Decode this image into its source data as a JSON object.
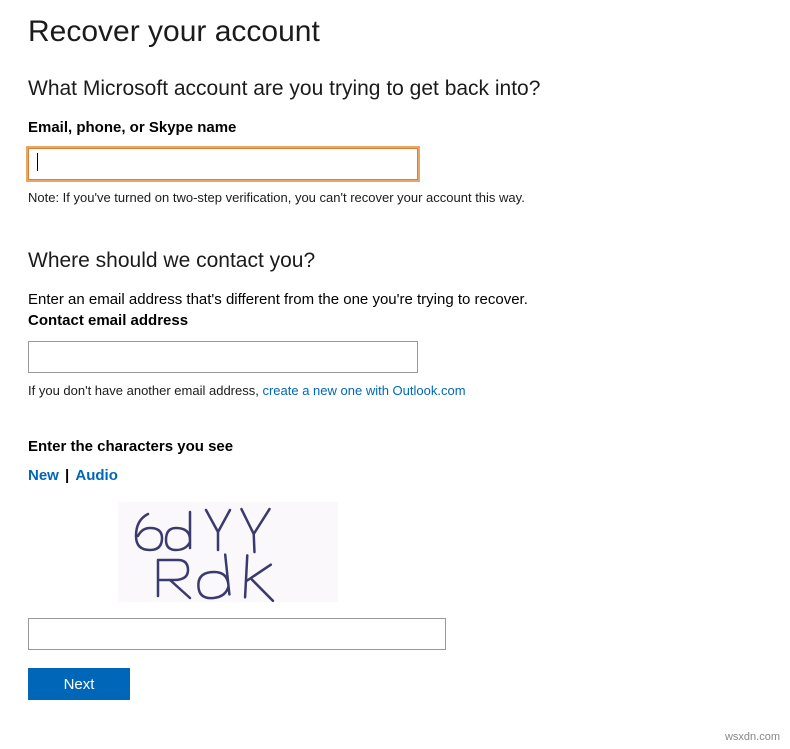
{
  "page_title": "Recover your account",
  "section1": {
    "heading": "What Microsoft account are you trying to get back into?",
    "label": "Email, phone, or Skype name",
    "input_value": "",
    "note": "Note: If you've turned on two-step verification, you can't recover your account this way."
  },
  "section2": {
    "heading": "Where should we contact you?",
    "instruction": "Enter an email address that's different from the one you're trying to recover.",
    "label": "Contact email address",
    "input_value": "",
    "link_prefix": "If you don't have another email address, ",
    "link_text": "create a new one with Outlook.com"
  },
  "captcha": {
    "label": "Enter the characters you see",
    "link_new": "New",
    "link_audio": "Audio",
    "separator": "|",
    "input_value": "",
    "image_text": "6dYY Rdk"
  },
  "next_button": "Next",
  "watermark": "wsxdn.com"
}
